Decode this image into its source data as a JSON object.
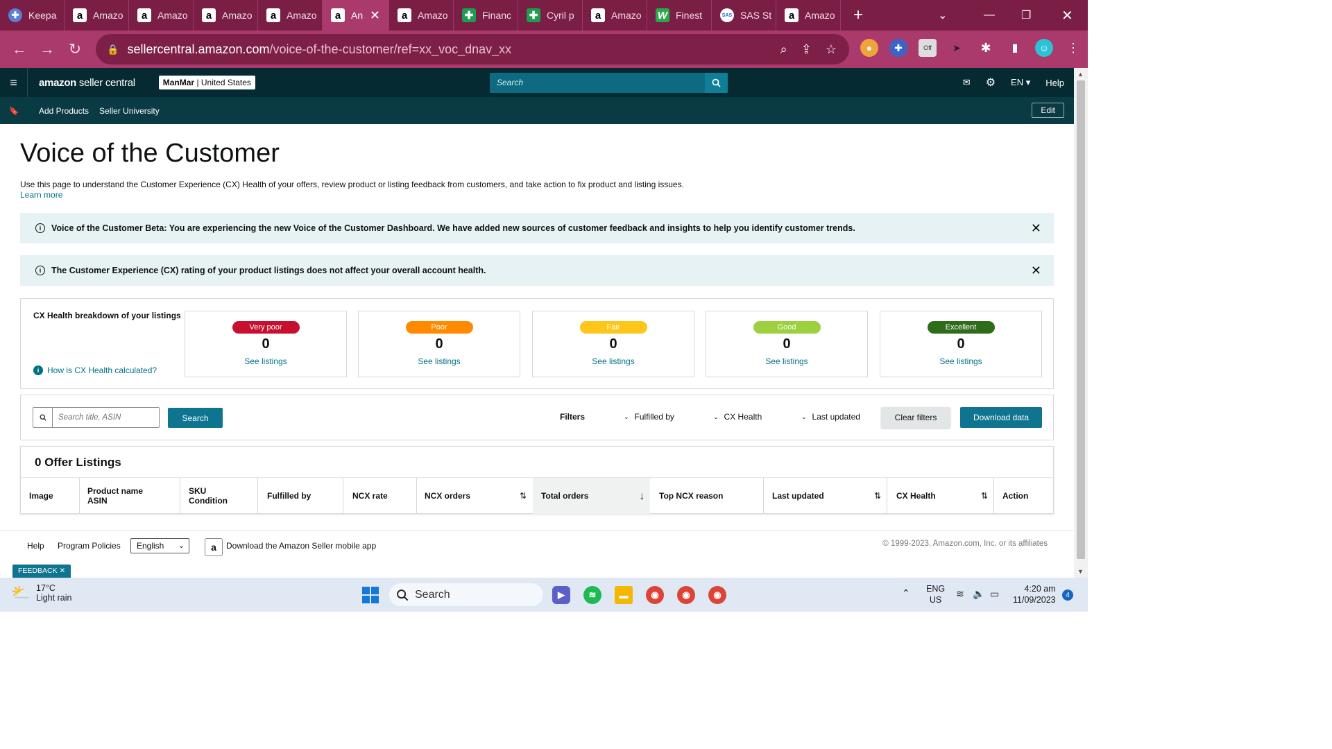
{
  "browser": {
    "tabs": [
      {
        "label": "Keepa",
        "icon": "keepa-icon"
      },
      {
        "label": "Amazo",
        "icon": "amazon-icon"
      },
      {
        "label": "Amazo",
        "icon": "amazon-icon"
      },
      {
        "label": "Amazo",
        "icon": "amazon-icon"
      },
      {
        "label": "Amazo",
        "icon": "amazon-icon"
      },
      {
        "label": "An",
        "icon": "amazon-icon",
        "active": true
      },
      {
        "label": "Amazo",
        "icon": "amazon-icon"
      },
      {
        "label": "Financ",
        "icon": "sheets-icon"
      },
      {
        "label": "Cyril p",
        "icon": "sheets-icon"
      },
      {
        "label": "Amazo",
        "icon": "amazon-icon"
      },
      {
        "label": "Finest",
        "icon": "w-icon"
      },
      {
        "label": "SAS St",
        "icon": "sas-icon"
      },
      {
        "label": "Amazo",
        "icon": "amazon-icon"
      }
    ],
    "url_domain": "sellercentral.amazon.com",
    "url_path": "/voice-of-the-customer/ref=xx_voc_dnav_xx",
    "extension_badge": "Off",
    "colors": {
      "tabbar": "#7b1e45",
      "addrbar": "#a93a6b"
    }
  },
  "header": {
    "brand_bold": "amazon",
    "brand_light": " seller central",
    "store_name": "ManMar",
    "store_region": " | United States",
    "search_placeholder": "Search",
    "lang": "EN",
    "help": "Help"
  },
  "subnav": {
    "links": [
      "Add Products",
      "Seller University"
    ],
    "edit": "Edit"
  },
  "page": {
    "title": "Voice of the Customer",
    "description": "Use this page to understand the Customer Experience (CX) Health of your offers, review product or listing feedback from customers, and take action to fix product and listing issues.",
    "learn_more": "Learn more"
  },
  "alerts": [
    "Voice of the Customer Beta: You are experiencing the new Voice of the Customer Dashboard. We have added new sources of customer feedback and insights to help you identify customer trends.",
    "The Customer Experience (CX) rating of your product listings does not affect your overall account health."
  ],
  "cx_health": {
    "title": "CX Health breakdown of your listings",
    "help_link": "How is CX Health calculated?",
    "cards": [
      {
        "label": "Very poor",
        "count": "0",
        "link": "See listings",
        "color": "#c7102f"
      },
      {
        "label": "Poor",
        "count": "0",
        "link": "See listings",
        "color": "#ff8a00"
      },
      {
        "label": "Fair",
        "count": "0",
        "link": "See listings",
        "color": "#ffc61a"
      },
      {
        "label": "Good",
        "count": "0",
        "link": "See listings",
        "color": "#9cd03f"
      },
      {
        "label": "Excellent",
        "count": "0",
        "link": "See listings",
        "color": "#2e6b1a"
      }
    ]
  },
  "filters": {
    "search_placeholder": "Search title, ASIN",
    "search_button": "Search",
    "label": "Filters",
    "dropdowns": [
      "Fulfilled by",
      "CX Health",
      "Last updated"
    ],
    "clear": "Clear filters",
    "download": "Download data"
  },
  "listings": {
    "title": "0 Offer Listings",
    "columns": [
      {
        "line1": "Image",
        "line2": ""
      },
      {
        "line1": "Product name",
        "line2": "ASIN"
      },
      {
        "line1": "SKU",
        "line2": "Condition"
      },
      {
        "line1": "Fulfilled by",
        "line2": ""
      },
      {
        "line1": "NCX rate",
        "line2": ""
      },
      {
        "line1": "NCX orders",
        "line2": ""
      },
      {
        "line1": "Total orders",
        "line2": ""
      },
      {
        "line1": "Top NCX reason",
        "line2": ""
      },
      {
        "line1": "Last updated",
        "line2": ""
      },
      {
        "line1": "CX Health",
        "line2": ""
      },
      {
        "line1": "Action",
        "line2": ""
      }
    ]
  },
  "footer": {
    "help": "Help",
    "policies": "Program Policies",
    "language": "English",
    "app_link": "Download the Amazon Seller mobile app",
    "copyright": "© 1999-2023, Amazon.com, Inc. or its affiliates",
    "feedback": "FEEDBACK"
  },
  "taskbar": {
    "temp": "17°C",
    "weather": "Light rain",
    "search": "Search",
    "lang_top": "ENG",
    "lang_bottom": "US",
    "time": "4:20 am",
    "date": "11/09/2023",
    "notifications": "4"
  }
}
